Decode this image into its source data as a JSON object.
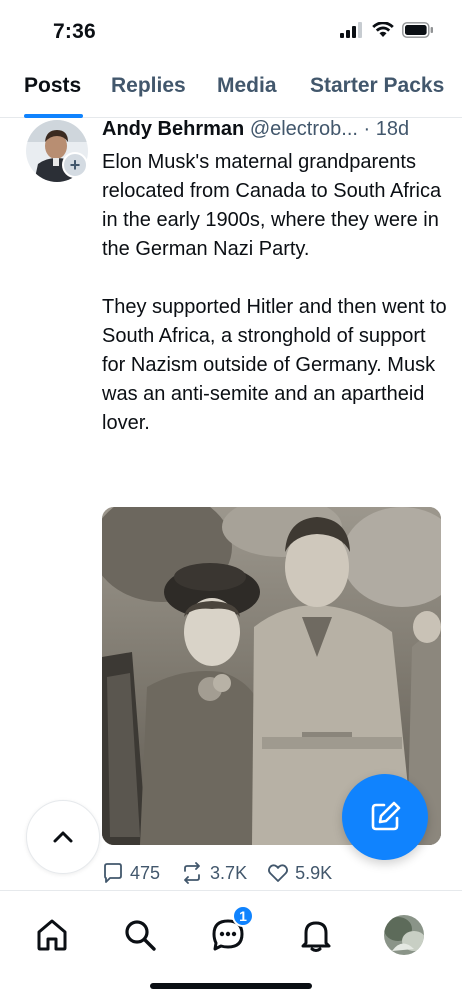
{
  "status_bar": {
    "time": "7:36"
  },
  "tabs": [
    {
      "label": "Posts",
      "active": true
    },
    {
      "label": "Replies",
      "active": false
    },
    {
      "label": "Media",
      "active": false
    },
    {
      "label": "Starter Packs",
      "active": false
    }
  ],
  "post": {
    "author_name": "Andy Behrman",
    "author_handle": "@electrob...",
    "separator": "·",
    "time": "18d",
    "text": "Elon Musk's maternal grandparents relocated from Canada to South Africa in the early 1900s, where they were in the German Nazi Party.\n\nThey supported Hitler and then went to South Africa, a stronghold of support for Nazism outside of Germany. Musk was an anti-semite and an apartheid lover.",
    "follow_badge": "+",
    "stats": {
      "replies": "475",
      "reposts": "3.7K",
      "likes": "5.9K"
    }
  },
  "nav": {
    "chat_badge": "1"
  },
  "icons": [
    "signal-icon",
    "wifi-icon",
    "battery-icon",
    "reply-icon",
    "repost-icon",
    "heart-icon",
    "chevron-up-icon",
    "compose-icon",
    "home-icon",
    "search-icon",
    "chat-icon",
    "bell-icon"
  ],
  "colors": {
    "accent": "#1083fe",
    "text_primary": "#0b0f14",
    "text_secondary": "#42576c",
    "divider": "#e6e9ec"
  }
}
